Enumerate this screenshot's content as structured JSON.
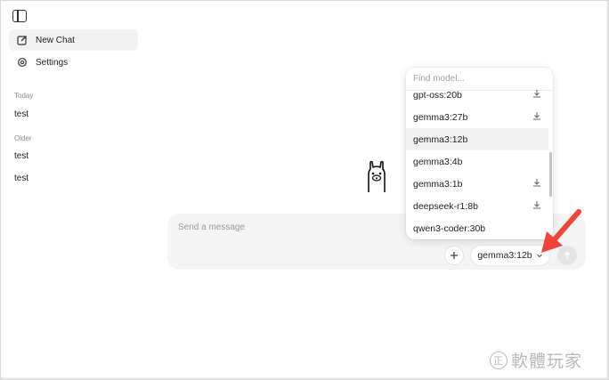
{
  "sidebar": {
    "new_chat_label": "New Chat",
    "settings_label": "Settings",
    "sections": [
      {
        "label": "Today",
        "chats": [
          "test"
        ]
      },
      {
        "label": "Older",
        "chats": [
          "test",
          "test"
        ]
      }
    ]
  },
  "composer": {
    "placeholder": "Send a message",
    "selected_model": "gemma3:12b"
  },
  "model_dropdown": {
    "search_placeholder": "Find model...",
    "models": [
      {
        "name": "gpt-oss:20b",
        "downloadable": true,
        "selected": false
      },
      {
        "name": "gemma3:27b",
        "downloadable": true,
        "selected": false
      },
      {
        "name": "gemma3:12b",
        "downloadable": false,
        "selected": true
      },
      {
        "name": "gemma3:4b",
        "downloadable": false,
        "selected": false
      },
      {
        "name": "gemma3:1b",
        "downloadable": true,
        "selected": false
      },
      {
        "name": "deepseek-r1:8b",
        "downloadable": true,
        "selected": false
      },
      {
        "name": "qwen3-coder:30b",
        "downloadable": false,
        "selected": false
      }
    ]
  },
  "watermark": {
    "symbol": "正",
    "text": "軟體玩家"
  },
  "colors": {
    "annotation_arrow": "#f0443a",
    "selected_row": "#f2f2f2",
    "composer_bg": "#f4f4f4"
  }
}
